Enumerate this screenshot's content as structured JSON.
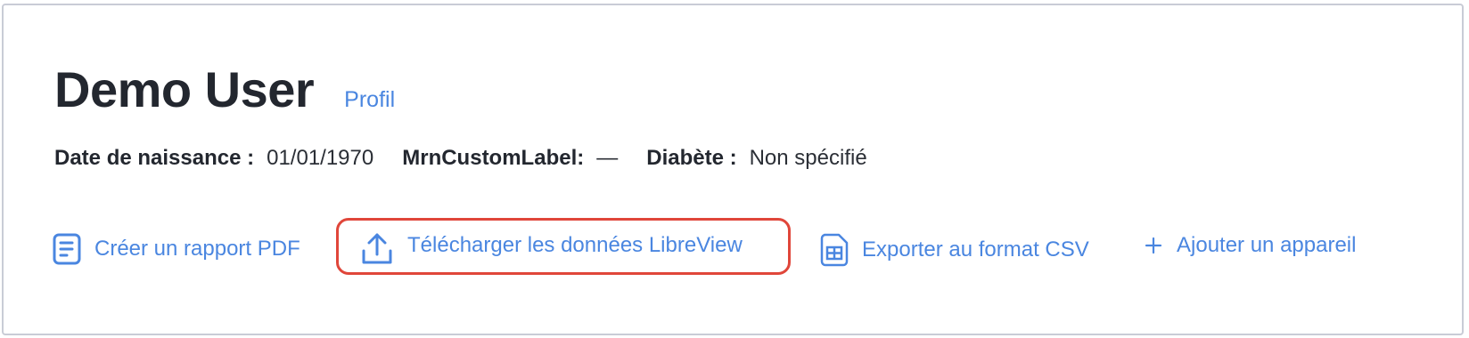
{
  "header": {
    "patient_name": "Demo User",
    "profile_link": "Profil"
  },
  "info": {
    "birthdate_label": "Date de naissance :",
    "birthdate_value": "01/01/1970",
    "mrn_label": "MrnCustomLabel:",
    "mrn_value": "—",
    "diabetes_label": "Diabète :",
    "diabetes_value": "Non spécifié"
  },
  "actions": {
    "pdf_report": {
      "label": "Créer un rapport PDF",
      "icon": "document-icon"
    },
    "upload_libreview": {
      "label": "Télécharger les données LibreView",
      "icon": "upload-icon"
    },
    "export_csv": {
      "label": "Exporter au format CSV",
      "icon": "spreadsheet-icon"
    },
    "add_device": {
      "label": "Ajouter un appareil",
      "icon": "plus-icon"
    }
  },
  "colors": {
    "accent": "#4a86e0",
    "highlight_border": "#e0463a",
    "text": "#23272f",
    "card_border": "#c9ccd6"
  }
}
